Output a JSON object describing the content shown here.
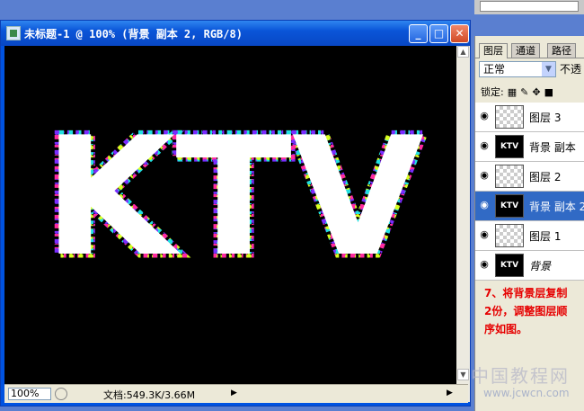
{
  "document_window": {
    "title": "未标题-1 @ 100% (背景 副本 2, RGB/8)",
    "minimize_label": "_",
    "maximize_label": "□",
    "close_label": "✕",
    "canvas_text": "KTV",
    "status": {
      "zoom": "100%",
      "doc_info": "文档:549.3K/3.66M",
      "arrow": "▶",
      "right_arrow": "▶"
    }
  },
  "layers_panel": {
    "tabs": [
      {
        "label": "图层"
      },
      {
        "label": "通道"
      },
      {
        "label": "路径"
      }
    ],
    "blend_mode": "正常",
    "opacity_label": "不透",
    "lock_label": "锁定:",
    "layers": [
      {
        "name": "图层 3",
        "thumb": "transparent",
        "selected": false
      },
      {
        "name": "背景 副本",
        "thumb": "KTV",
        "selected": false
      },
      {
        "name": "图层 2",
        "thumb": "transparent",
        "selected": false
      },
      {
        "name": "背景 副本 2",
        "thumb": "KTV",
        "selected": true
      },
      {
        "name": "图层 1",
        "thumb": "transparent",
        "selected": false
      },
      {
        "name": "背景",
        "thumb": "KTV",
        "selected": false
      }
    ]
  },
  "instruction": {
    "line1": "7、将背景层复制",
    "line2": "2份，调整图层顺",
    "line3": "序如图。"
  },
  "watermark": {
    "site_name": "中国教程网",
    "url": "www.jcwcn.com"
  },
  "colors": {
    "titlebar": "#0a55d8",
    "canvas": "#000000",
    "selected_layer": "#316ac5",
    "instruction_text": "#e60000"
  }
}
